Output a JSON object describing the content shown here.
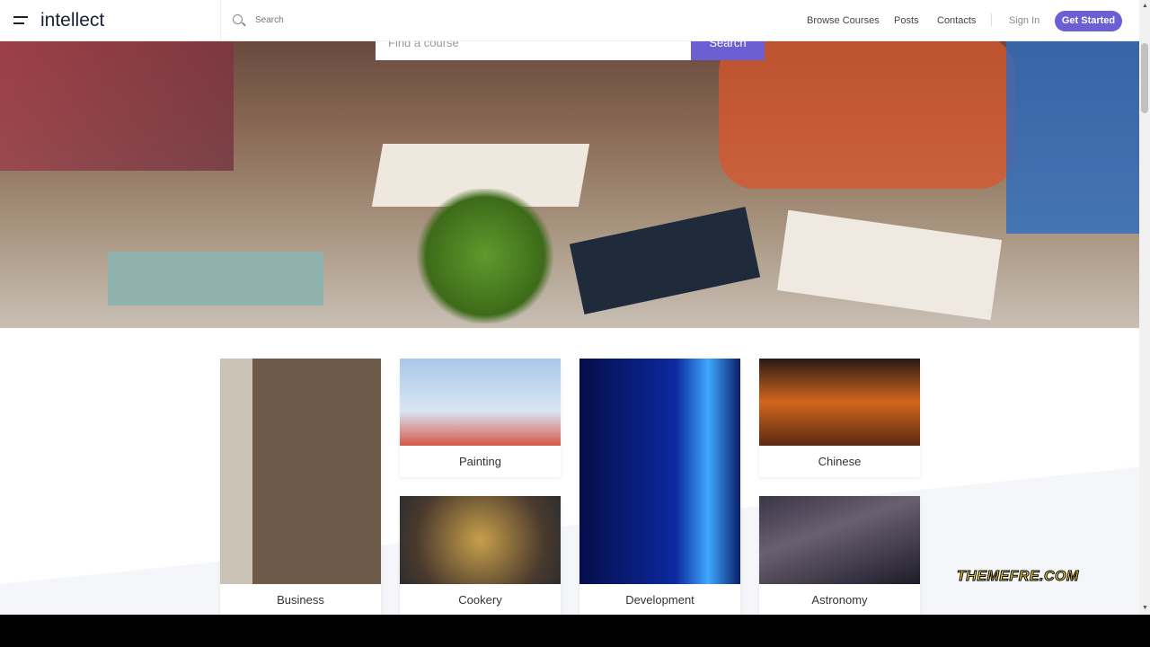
{
  "header": {
    "logo": "intellect",
    "search_placeholder": "Search",
    "nav": [
      "Browse Courses",
      "Posts",
      "Contacts"
    ],
    "sign_in": "Sign In",
    "get_started": "Get Started"
  },
  "hero": {
    "find_placeholder": "Find a course",
    "search_button": "Search"
  },
  "categories": [
    {
      "label": "Business"
    },
    {
      "label": "Painting"
    },
    {
      "label": "Chinese"
    },
    {
      "label": "Cookery"
    },
    {
      "label": "Development"
    },
    {
      "label": "Astronomy"
    }
  ],
  "watermark": "THEMEFRE.COM",
  "colors": {
    "accent": "#6b5fd3"
  }
}
